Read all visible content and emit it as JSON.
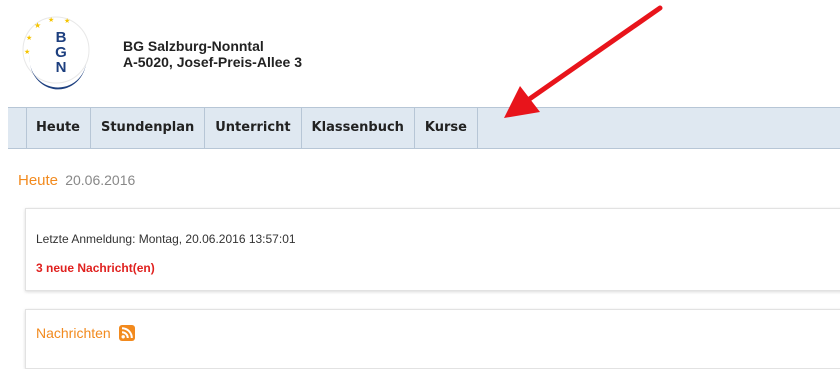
{
  "school": {
    "logo_letters": "BGN",
    "name": "BG Salzburg-Nonntal",
    "address": "A-5020, Josef-Preis-Allee 3"
  },
  "nav": {
    "tabs": [
      "Heute",
      "Stundenplan",
      "Unterricht",
      "Klassenbuch",
      "Kurse"
    ]
  },
  "page": {
    "title": "Heute",
    "date": "20.06.2016"
  },
  "status": {
    "last_login": "Letzte Anmeldung: Montag, 20.06.2016 13:57:01",
    "new_messages": "3 neue Nachricht(en)"
  },
  "news": {
    "title": "Nachrichten",
    "feed_icon": "rss-icon"
  },
  "colors": {
    "accent": "#f28a1e",
    "alert": "#e0211f",
    "nav_bg": "#dfe8f1",
    "annotation_arrow": "#e8141b"
  }
}
